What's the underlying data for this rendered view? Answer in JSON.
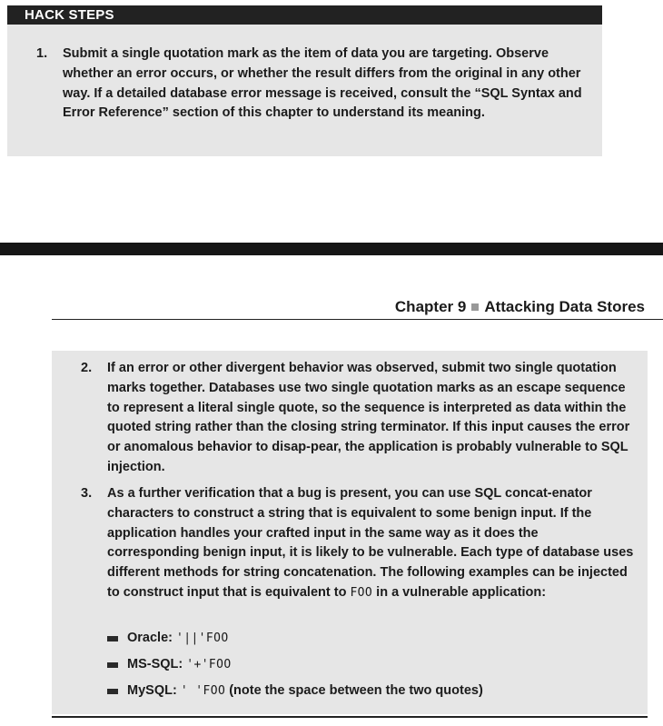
{
  "hack_steps": {
    "header": "HACK STEPS",
    "step1": {
      "number": "1.",
      "text": "Submit a single quotation mark as the item of data you are targeting. Observe whether an error occurs, or whether the result differs from the original in any other way. If a detailed database error message is received, consult the “SQL Syntax and Error Reference” section of this chapter to understand its meaning."
    }
  },
  "running_header": {
    "chapter": "Chapter 9",
    "title": "Attacking Data Stores"
  },
  "continued": {
    "step2": {
      "number": "2.",
      "text": "If an error or other divergent behavior was observed, submit two single quotation marks together. Databases use two single quotation marks as an escape sequence to represent a literal single quote, so the sequence is interpreted as data within the quoted string rather than the closing string terminator. If this input causes the error or anomalous behavior to disap-pear, the application is probably vulnerable to SQL injection."
    },
    "step3": {
      "number": "3.",
      "text": "As a further verification that a bug is present, you can use SQL concat-enator characters to construct a string that is equivalent to some benign input. If the application handles your crafted input in the same way as it does the corresponding benign input, it is likely to be vulnerable. Each type of database uses different methods for string concatenation. The following examples can be injected to construct input that is equivalent to",
      "tail_code": "FOO",
      "tail_text": " in a vulnerable application:"
    },
    "bullets": [
      {
        "label": "Oracle: ",
        "code": "'||'FOO",
        "note": ""
      },
      {
        "label": "MS-SQL: ",
        "code": "'+'FOO",
        "note": ""
      },
      {
        "label": "MySQL: ",
        "code": "' 'FOO",
        "note": " (note the space between the two quotes)"
      }
    ]
  }
}
